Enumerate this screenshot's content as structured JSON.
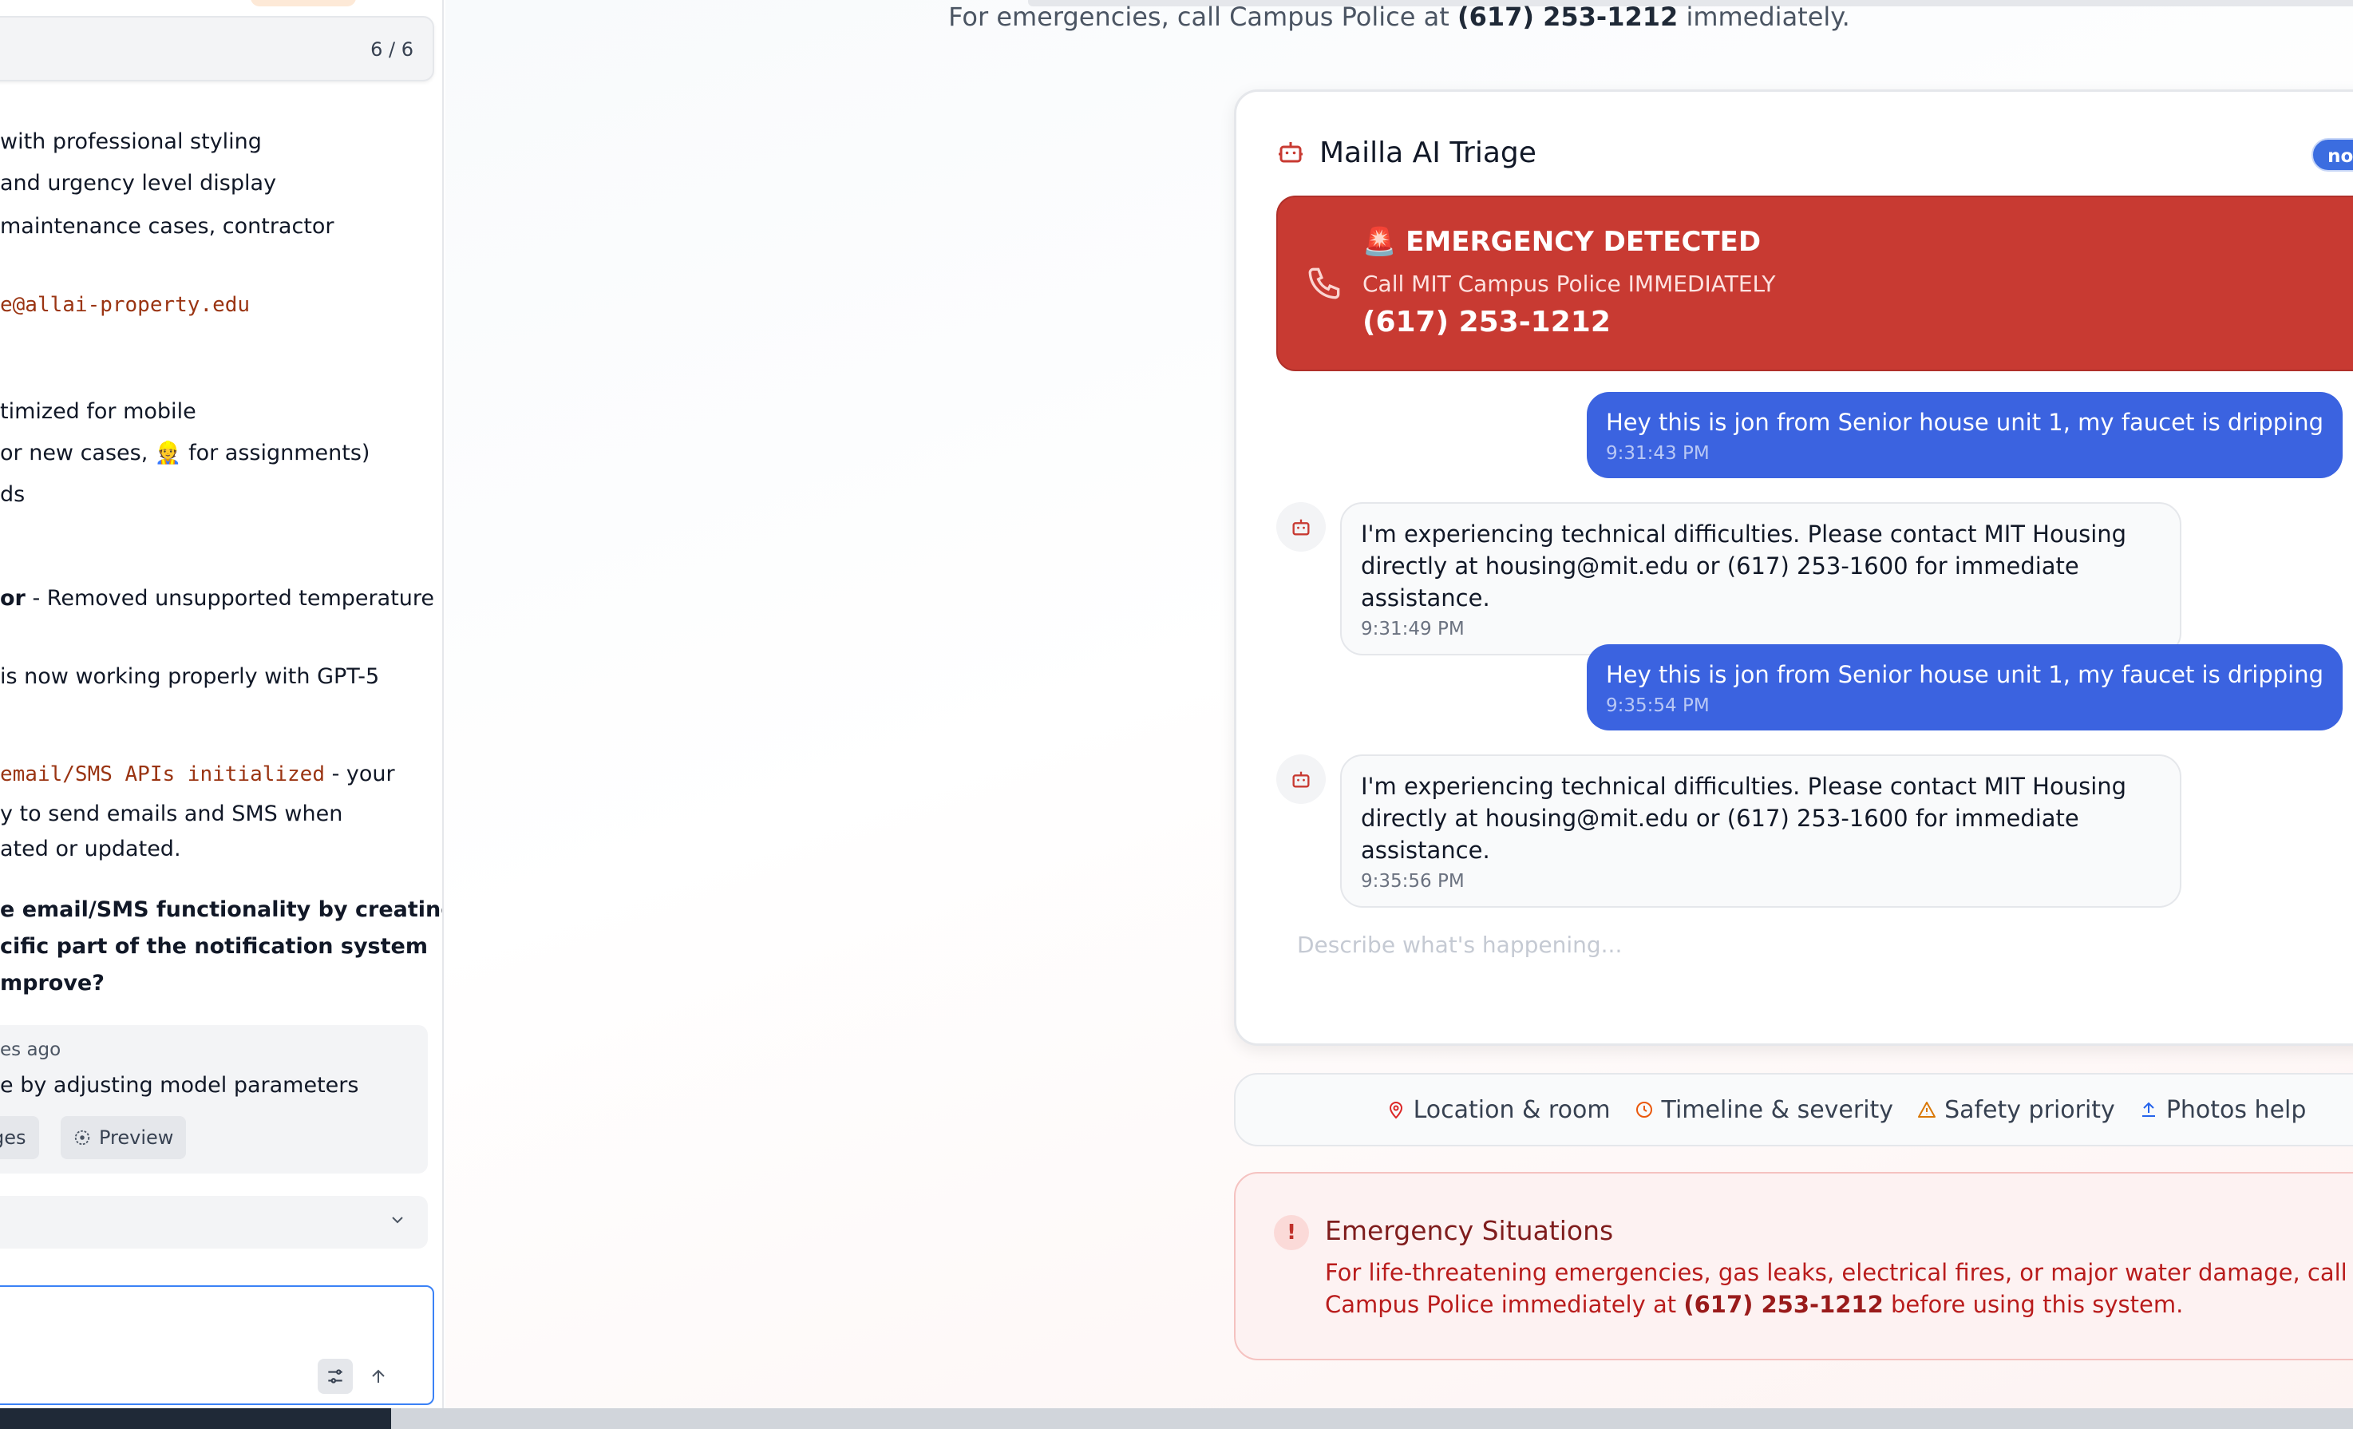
{
  "left_panel": {
    "counter": "6 / 6",
    "lines": [
      {
        "text": "with professional styling"
      },
      {
        "text": " and urgency level display"
      },
      {
        "text": "maintenance cases, contractor"
      },
      {
        "text": "e@allai-property.edu"
      },
      {
        "text": "timized for mobile"
      },
      {
        "text": "or new cases, 👷 for assignments)"
      },
      {
        "text": "ds"
      },
      {
        "bold": "or",
        "text": " - Removed unsupported temperature"
      },
      {
        "text": " is now working properly with GPT-5"
      },
      {
        "code": "email/SMS APIs initialized",
        "text": " - your"
      },
      {
        "text": "y to send emails and SMS when"
      },
      {
        "text": "ated or updated."
      }
    ],
    "question": [
      "e email/SMS functionality by creating a",
      "cific part of the notification system",
      "mprove?"
    ],
    "history_card": {
      "time": "es ago",
      "text": "e by adjusting model parameters",
      "btn_changes": "ges",
      "btn_preview": "Preview"
    }
  },
  "main": {
    "top_note_prefix": "For emergencies, call Campus Police at",
    "top_note_phone": "(617) 253-1212",
    "top_note_suffix": "immediately.",
    "chat": {
      "title": "Mailla AI Triage",
      "badge": "normal",
      "alert": {
        "heading": "🚨 EMERGENCY DETECTED",
        "subtext": "Call MIT Campus Police IMMEDIATELY",
        "phone": "(617) 253-1212"
      },
      "messages": [
        {
          "role": "user",
          "text": "Hey this is jon from Senior house unit 1, my faucet is dripping",
          "time": "9:31:43 PM"
        },
        {
          "role": "assistant",
          "text": "I'm experiencing technical difficulties. Please contact MIT Housing directly at housing@mit.edu or (617) 253-1600 for immediate assistance.",
          "time": "9:31:49 PM"
        },
        {
          "role": "user",
          "text": "Hey this is jon from Senior house unit 1, my faucet is dripping",
          "time": "9:35:54 PM"
        },
        {
          "role": "assistant",
          "text": "I'm experiencing technical difficulties. Please contact MIT Housing directly at housing@mit.edu or (617) 253-1600 for immediate assistance.",
          "time": "9:35:56 PM"
        }
      ],
      "input_placeholder": "Describe what's happening..."
    },
    "tips": [
      {
        "icon": "map-pin-icon",
        "label": "Location & room",
        "color": "#dc2626"
      },
      {
        "icon": "clock-icon",
        "label": "Timeline & severity",
        "color": "#ea580c"
      },
      {
        "icon": "warning-icon",
        "label": "Safety priority",
        "color": "#d97706"
      },
      {
        "icon": "upload-icon",
        "label": "Photos help",
        "color": "#2563eb"
      }
    ],
    "emergency_info": {
      "title": "Emergency Situations",
      "text_before": "For life-threatening emergencies, gas leaks, electrical fires, or major water damage, call Campus Police immediately at",
      "phone": "(617) 253-1212",
      "text_after": "before using this system."
    }
  }
}
